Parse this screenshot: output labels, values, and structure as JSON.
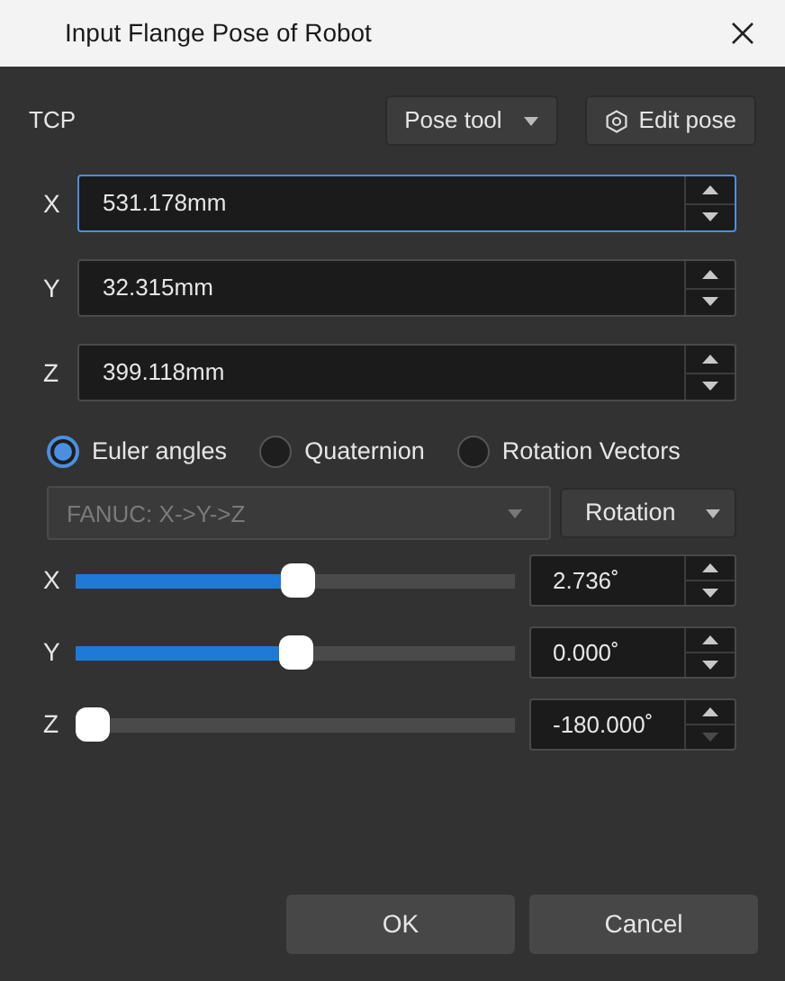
{
  "window": {
    "title": "Input Flange Pose of Robot"
  },
  "tcp": {
    "label": "TCP",
    "pose_tool": "Pose tool",
    "edit_pose": "Edit pose"
  },
  "position": [
    {
      "label": "X",
      "value": "531.178mm",
      "focused": true
    },
    {
      "label": "Y",
      "value": "32.315mm",
      "focused": false
    },
    {
      "label": "Z",
      "value": "399.118mm",
      "focused": false
    }
  ],
  "rotation_modes": [
    {
      "label": "Euler angles",
      "selected": true
    },
    {
      "label": "Quaternion",
      "selected": false
    },
    {
      "label": "Rotation Vectors",
      "selected": false
    }
  ],
  "convention": {
    "value": "FANUC: X->Y->Z",
    "disabled": true
  },
  "rotation_type": "Rotation",
  "angles": [
    {
      "label": "X",
      "level": 0.508,
      "value": "2.736˚",
      "down_disabled": false
    },
    {
      "label": "Y",
      "level": 0.5,
      "value": "0.000˚",
      "down_disabled": false
    },
    {
      "label": "Z",
      "level": 0,
      "value": "-180.000˚",
      "down_disabled": true
    }
  ],
  "buttons": [
    {
      "label": "OK"
    },
    {
      "label": "Cancel"
    }
  ]
}
